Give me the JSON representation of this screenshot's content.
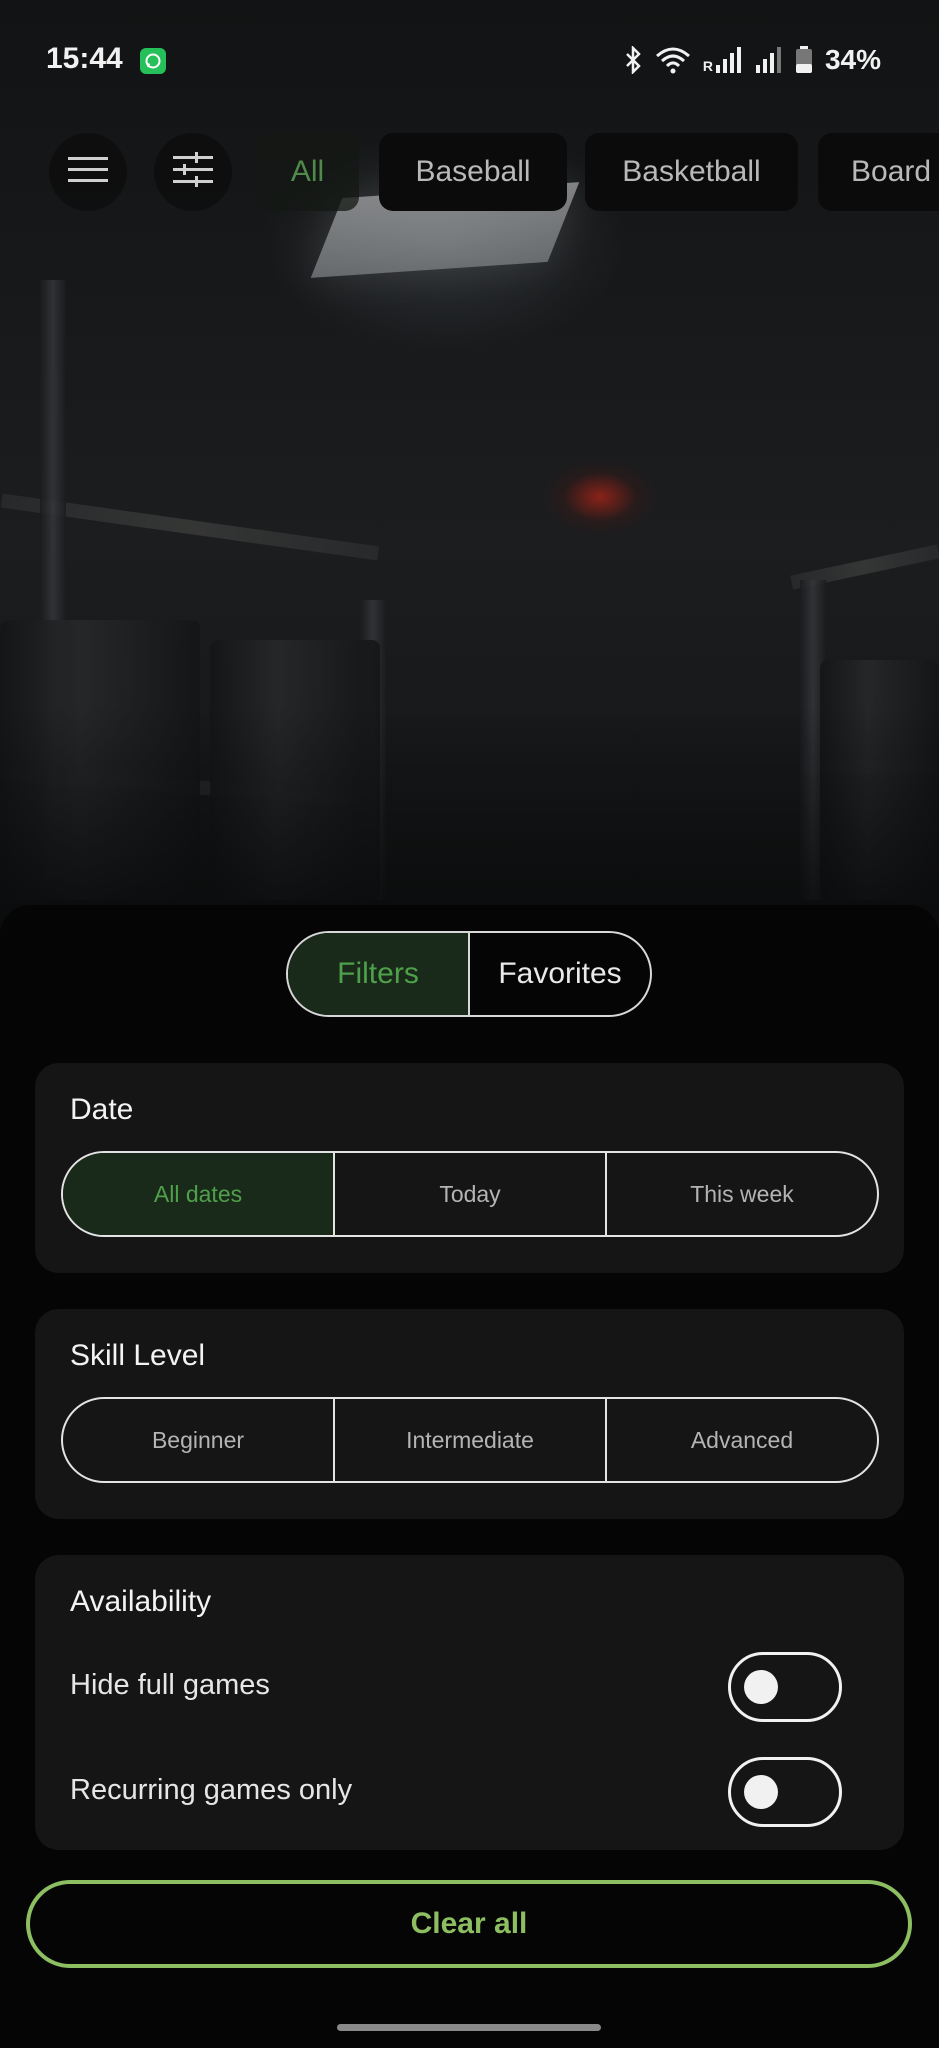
{
  "status_bar": {
    "time": "15:44",
    "notification_icon": "whatsapp-icon",
    "icons": [
      "bluetooth-icon",
      "wifi-icon",
      "signal-icon",
      "signal-icon",
      "battery-icon"
    ],
    "roaming_indicator": "R",
    "battery": "34%"
  },
  "top_bar": {
    "menu_icon": "menu-icon",
    "filter_icon": "sliders-icon",
    "categories": [
      "All",
      "Baseball",
      "Basketball",
      "Board"
    ],
    "selected_category": "All"
  },
  "sheet": {
    "tabs": [
      "Filters",
      "Favorites"
    ],
    "selected_tab": "Filters",
    "date": {
      "title": "Date",
      "options": [
        "All dates",
        "Today",
        "This week"
      ],
      "selected": "All dates"
    },
    "skill": {
      "title": "Skill Level",
      "options": [
        "Beginner",
        "Intermediate",
        "Advanced"
      ]
    },
    "availability": {
      "title": "Availability",
      "hide_full_label": "Hide full games",
      "hide_full_on": false,
      "recurring_label": "Recurring games only",
      "recurring_on": false
    },
    "clear_all_label": "Clear all"
  },
  "colors": {
    "accent_green": "#8dbf62",
    "selected_green": "#4fa04a",
    "card_bg": "#151515"
  }
}
